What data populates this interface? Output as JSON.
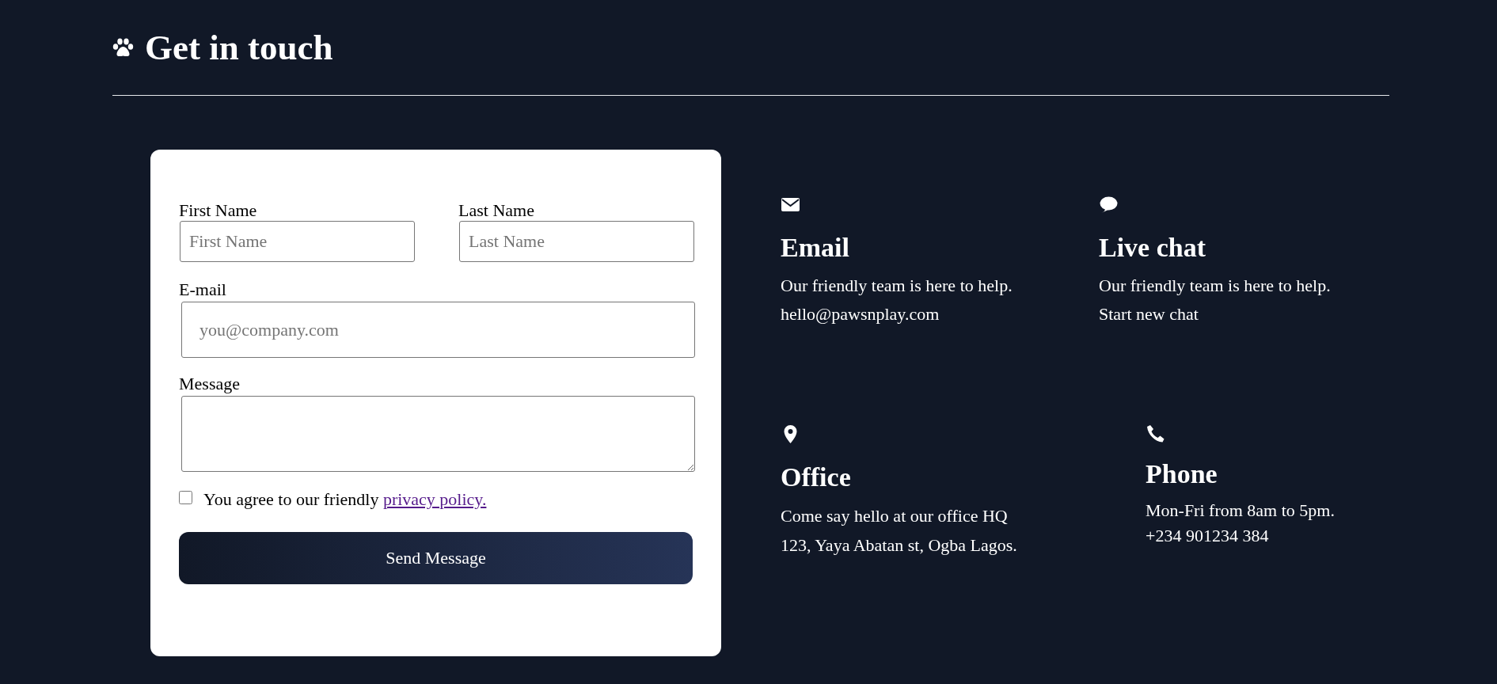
{
  "header": {
    "title": "Get in touch"
  },
  "form": {
    "first_name": {
      "label": "First Name",
      "placeholder": "First Name"
    },
    "last_name": {
      "label": "Last Name",
      "placeholder": "Last Name"
    },
    "email": {
      "label": "E-mail",
      "placeholder": "you@company.com"
    },
    "message": {
      "label": "Message"
    },
    "agree": {
      "text": "You agree to our friendly",
      "link": "privacy policy.",
      "checked": false
    },
    "submit": "Send Message"
  },
  "contacts": [
    {
      "kind": "email",
      "title": "Email",
      "lines": [
        "Our friendly team is here to help.",
        "hello@pawsnplay.com"
      ]
    },
    {
      "kind": "chat",
      "title": "Live chat",
      "lines": [
        "Our friendly team is here to help.",
        "Start new chat"
      ]
    },
    {
      "kind": "office",
      "title": "Office",
      "lines": [
        "Come say hello at our office HQ",
        "123, Yaya Abatan st, Ogba Lagos."
      ]
    },
    {
      "kind": "phone",
      "title": "Phone",
      "lines": [
        "Mon-Fri from 8am to 5pm.",
        "+234 901234 384"
      ]
    }
  ]
}
